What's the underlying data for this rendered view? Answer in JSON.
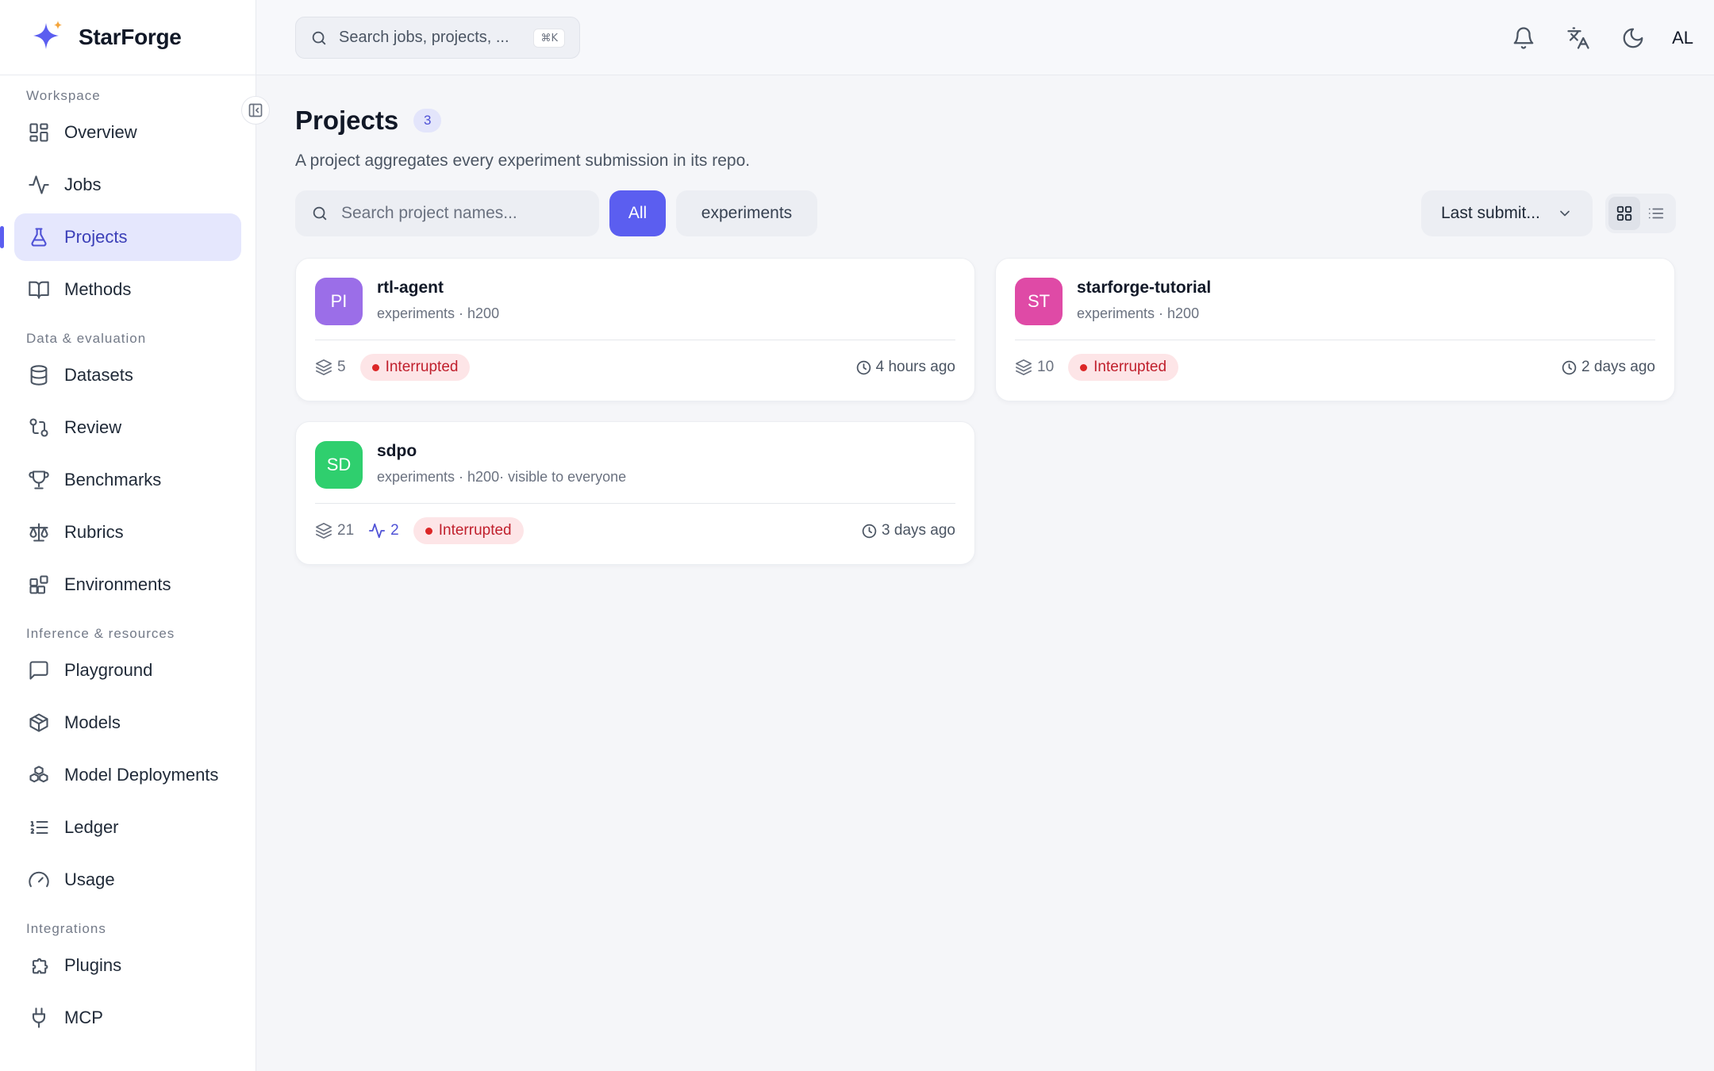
{
  "app": {
    "name": "StarForge"
  },
  "search": {
    "placeholder": "Search jobs, projects, ...",
    "shortcut": "⌘K"
  },
  "header": {
    "user_initials": "AL"
  },
  "sidebar": {
    "sections": [
      {
        "title": "Workspace",
        "items": [
          {
            "label": "Overview",
            "icon": "grid-icon"
          },
          {
            "label": "Jobs",
            "icon": "activity-icon"
          },
          {
            "label": "Projects",
            "icon": "flask-icon",
            "active": true
          },
          {
            "label": "Methods",
            "icon": "book-icon"
          }
        ]
      },
      {
        "title": "Data & evaluation",
        "items": [
          {
            "label": "Datasets",
            "icon": "database-icon"
          },
          {
            "label": "Review",
            "icon": "git-compare-icon"
          },
          {
            "label": "Benchmarks",
            "icon": "trophy-icon"
          },
          {
            "label": "Rubrics",
            "icon": "scale-icon"
          },
          {
            "label": "Environments",
            "icon": "blocks-icon"
          }
        ]
      },
      {
        "title": "Inference & resources",
        "items": [
          {
            "label": "Playground",
            "icon": "message-square-icon"
          },
          {
            "label": "Models",
            "icon": "package-icon"
          },
          {
            "label": "Model Deployments",
            "icon": "boxes-icon"
          },
          {
            "label": "Ledger",
            "icon": "list-ordered-icon"
          },
          {
            "label": "Usage",
            "icon": "gauge-icon"
          }
        ]
      },
      {
        "title": "Integrations",
        "items": [
          {
            "label": "Plugins",
            "icon": "puzzle-icon"
          },
          {
            "label": "MCP",
            "icon": "plug-icon"
          }
        ]
      }
    ]
  },
  "main": {
    "title": "Projects",
    "count": "3",
    "subtitle": "A project aggregates every experiment submission in its repo.",
    "search_placeholder": "Search project names...",
    "filters": [
      "All",
      "experiments"
    ],
    "active_filter": "All",
    "sort_label": "Last submit...",
    "view_mode": "grid"
  },
  "projects": [
    {
      "initials": "PI",
      "name": "rtl-agent",
      "meta": "experiments · h200",
      "submissions": "5",
      "active_jobs": "",
      "status": "Interrupted",
      "time": "4 hours ago",
      "color": "#9b6ee8"
    },
    {
      "initials": "ST",
      "name": "starforge-tutorial",
      "meta": "experiments · h200",
      "submissions": "10",
      "active_jobs": "",
      "status": "Interrupted",
      "time": "2 days ago",
      "color": "#df4aa6"
    },
    {
      "initials": "SD",
      "name": "sdpo",
      "meta": "experiments · h200· visible to everyone",
      "submissions": "21",
      "active_jobs": "2",
      "status": "Interrupted",
      "time": "3 days ago",
      "color": "#2fcf6e"
    }
  ],
  "colors": {
    "accent": "#5b5ef0",
    "status_interrupted": "#dc2626"
  }
}
